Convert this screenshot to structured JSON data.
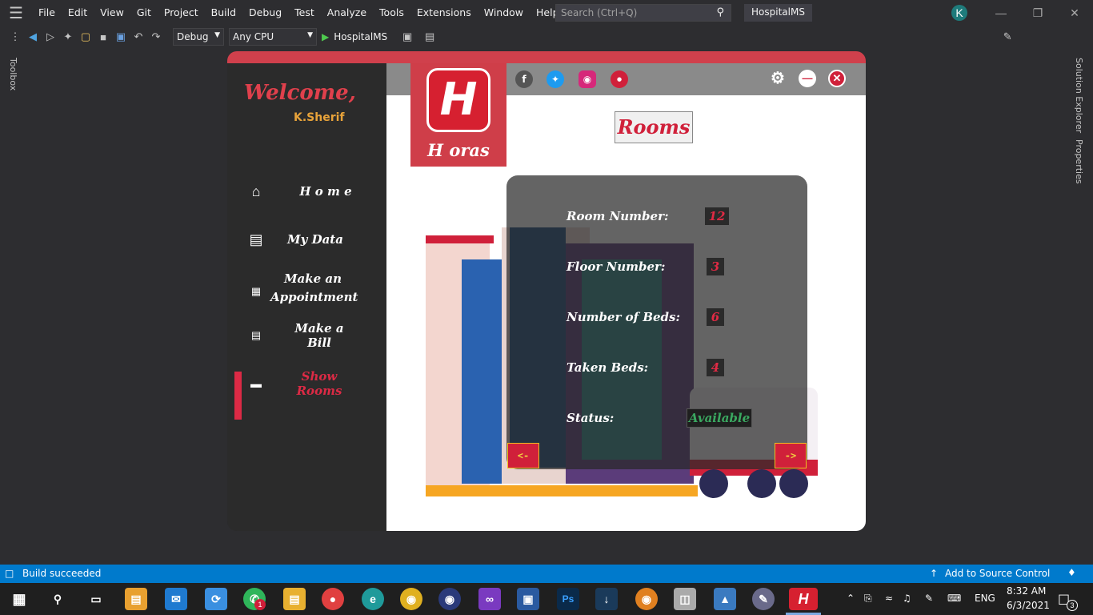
{
  "vs": {
    "menu": [
      "File",
      "Edit",
      "View",
      "Git",
      "Project",
      "Build",
      "Debug",
      "Test",
      "Analyze",
      "Tools",
      "Extensions",
      "Window",
      "Help"
    ],
    "search_placeholder": "Search (Ctrl+Q)",
    "project_title": "HospitalMS",
    "user_initial": "K",
    "config": "Debug",
    "platform": "Any CPU",
    "run_target": "HospitalMS",
    "toolbox_tab": "Toolbox",
    "solution_explorer_tab": "Solution Explorer",
    "properties_tab": "Properties",
    "status_text": "Build succeeded",
    "source_control": "Add to Source Control"
  },
  "app": {
    "welcome": "Welcome,",
    "username": "K.Sherif",
    "logo_letter": "H",
    "logo_text": "H oras",
    "nav": {
      "home": "H o m e",
      "my_data": "My Data",
      "appointment_line1": "Make an",
      "appointment_line2": "Appointment",
      "bill": "Make a Bill",
      "rooms": "Show Rooms"
    },
    "page_title": "Rooms",
    "fields": {
      "room_number_label": "Room Number:",
      "room_number": "12",
      "floor_number_label": "Floor Number:",
      "floor_number": "3",
      "beds_label": "Number of Beds:",
      "beds": "6",
      "taken_label": "Taken Beds:",
      "taken": "4",
      "status_label": "Status:",
      "status": "Available"
    },
    "prev_label": "<-",
    "next_label": "->",
    "colors": {
      "accent": "#d0203a",
      "header": "#8a8a8a",
      "sidebar": "#2b2b2b",
      "status_ok": "#3aa860"
    }
  },
  "taskbar": {
    "lang": "ENG",
    "time": "8:32 AM",
    "date": "6/3/2021",
    "whatsapp_badge": "1",
    "notif_count": "3"
  }
}
